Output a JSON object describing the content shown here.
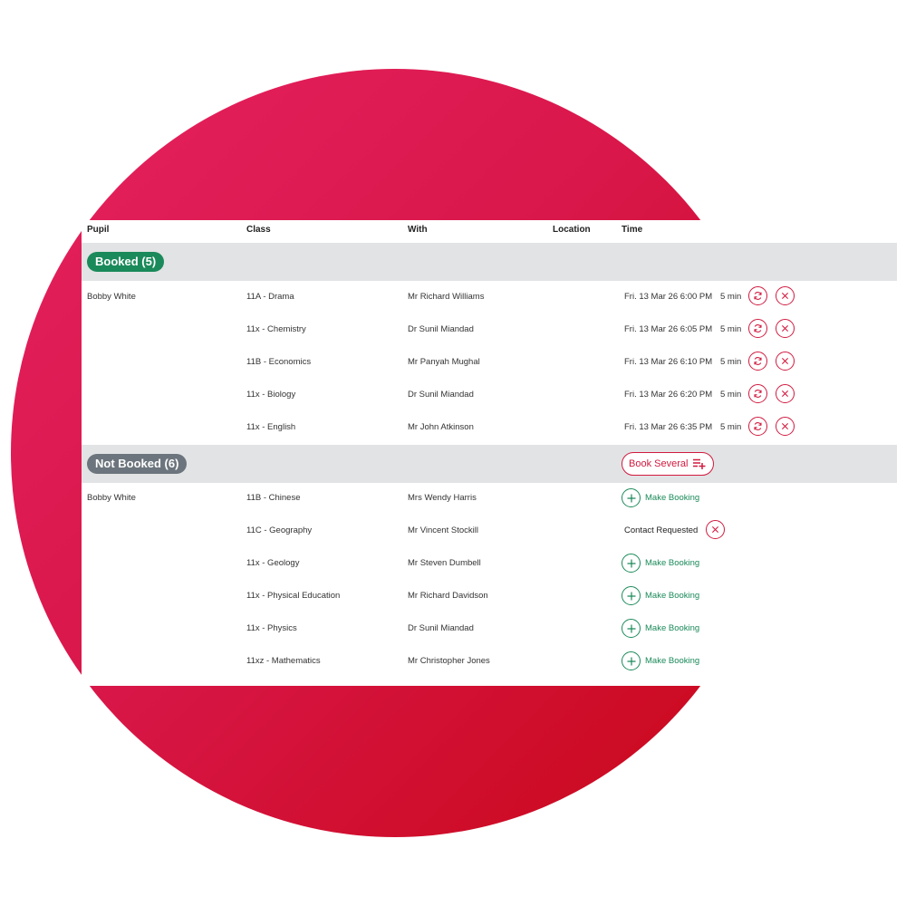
{
  "columns": {
    "pupil": "Pupil",
    "class": "Class",
    "with": "With",
    "location": "Location",
    "time": "Time"
  },
  "booked": {
    "label": "Booked (5)",
    "rows": [
      {
        "pupil": "Bobby White",
        "class": "11A - Drama",
        "with": "Mr Richard Williams",
        "time": "Fri. 13 Mar 26 6:00 PM",
        "duration": "5 min"
      },
      {
        "pupil": "",
        "class": "11x - Chemistry",
        "with": "Dr Sunil Miandad",
        "time": "Fri. 13 Mar 26 6:05 PM",
        "duration": "5 min"
      },
      {
        "pupil": "",
        "class": "11B - Economics",
        "with": "Mr Panyah Mughal",
        "time": "Fri. 13 Mar 26 6:10 PM",
        "duration": "5 min"
      },
      {
        "pupil": "",
        "class": "11x - Biology",
        "with": "Dr Sunil Miandad",
        "time": "Fri. 13 Mar 26 6:20 PM",
        "duration": "5 min"
      },
      {
        "pupil": "",
        "class": "11x - English",
        "with": "Mr John Atkinson",
        "time": "Fri. 13 Mar 26 6:35 PM",
        "duration": "5 min"
      }
    ]
  },
  "not_booked": {
    "label": "Not Booked (6)",
    "book_several_label": "Book Several",
    "make_booking_label": "Make Booking",
    "contact_requested_label": "Contact Requested",
    "rows": [
      {
        "pupil": "Bobby White",
        "class": "11B - Chinese",
        "with": "Mrs Wendy Harris",
        "status": "make_booking"
      },
      {
        "pupil": "",
        "class": "11C - Geography",
        "with": "Mr Vincent Stockill",
        "status": "contact_requested"
      },
      {
        "pupil": "",
        "class": "11x - Geology",
        "with": "Mr Steven Dumbell",
        "status": "make_booking"
      },
      {
        "pupil": "",
        "class": "11x - Physical Education",
        "with": "Mr Richard Davidson",
        "status": "make_booking"
      },
      {
        "pupil": "",
        "class": "11x - Physics",
        "with": "Dr Sunil Miandad",
        "status": "make_booking"
      },
      {
        "pupil": "",
        "class": "11xz - Mathematics",
        "with": "Mr Christopher Jones",
        "status": "make_booking"
      }
    ]
  },
  "colors": {
    "booked_green": "#1a8a5a",
    "not_booked_grey": "#6c757d",
    "action_red": "#d11a3f",
    "group_bar": "#e2e3e4"
  },
  "icons": {
    "swap": "swap-icon",
    "cancel": "close-icon",
    "add": "plus-icon",
    "book_several": "playlist-add-icon"
  }
}
